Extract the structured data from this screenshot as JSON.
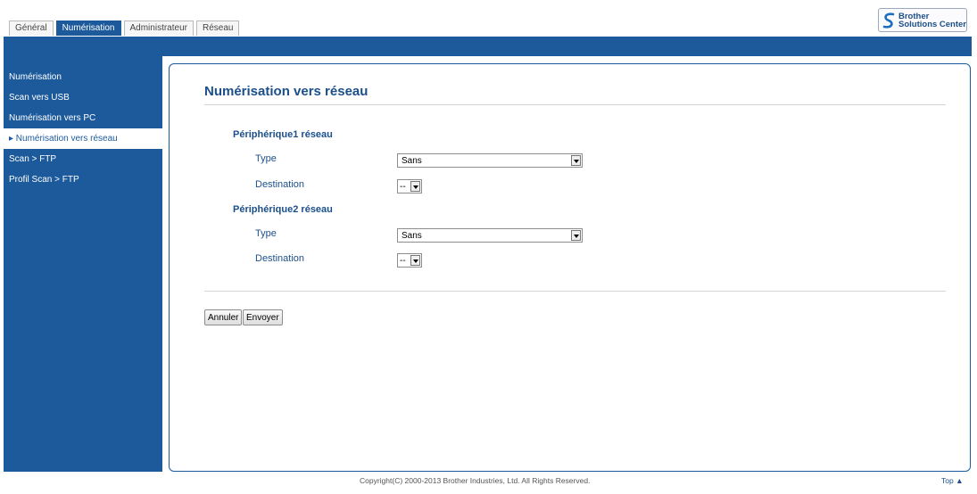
{
  "tabs": [
    {
      "label": "Général",
      "active": false
    },
    {
      "label": "Numérisation",
      "active": true
    },
    {
      "label": "Administrateur",
      "active": false
    },
    {
      "label": "Réseau",
      "active": false
    }
  ],
  "brand": {
    "line1": "Brother",
    "line2": "Solutions Center",
    "icon": "brother-s-logo-icon"
  },
  "sidebar": {
    "items": [
      {
        "label": "Numérisation"
      },
      {
        "label": "Scan vers USB"
      },
      {
        "label": "Numérisation vers PC"
      },
      {
        "label": "▸ Numérisation vers réseau",
        "active": true
      },
      {
        "label": "Scan > FTP"
      },
      {
        "label": "Profil Scan > FTP"
      }
    ]
  },
  "main": {
    "title": "Numérisation vers réseau",
    "devices": [
      {
        "title": "Périphérique1 réseau",
        "type_label": "Type",
        "type_value": "Sans",
        "dest_label": "Destination",
        "dest_value": "--"
      },
      {
        "title": "Périphérique2 réseau",
        "type_label": "Type",
        "type_value": "Sans",
        "dest_label": "Destination",
        "dest_value": "--"
      }
    ],
    "buttons": {
      "cancel": "Annuler",
      "send": "Envoyer"
    }
  },
  "footer": {
    "copyright": "Copyright(C) 2000-2013 Brother Industries, Ltd. All Rights Reserved.",
    "top_link": "Top ▲"
  },
  "colors": {
    "accent": "#1c5a9c",
    "heading": "#1c4f8a"
  }
}
